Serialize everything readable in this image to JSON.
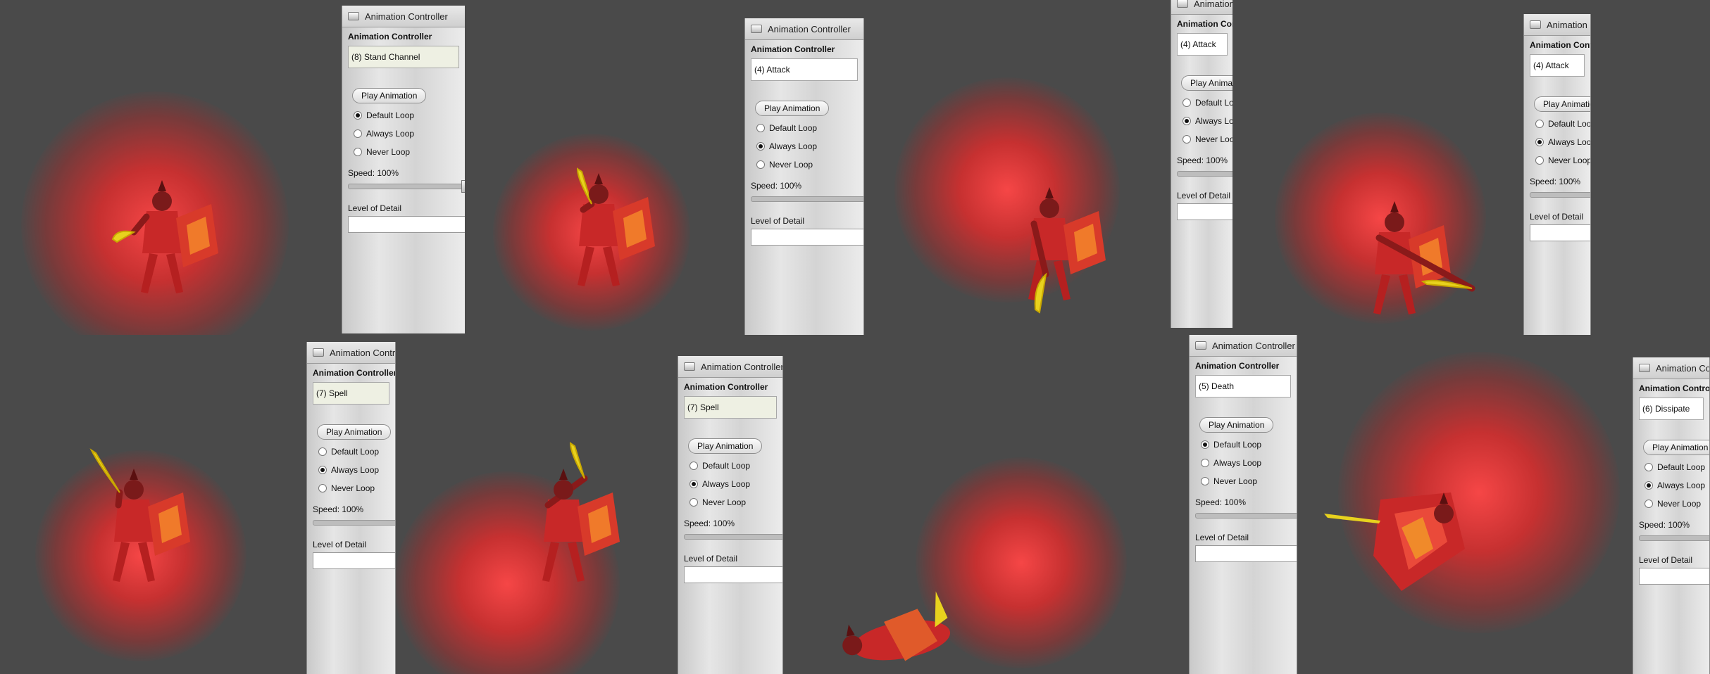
{
  "colors": {
    "background": "#4a4a4a",
    "glow": "#ff3b3b",
    "armor": "#c82828",
    "blade": "#e8d21e"
  },
  "panel_common": {
    "window_title": "Animation Controller",
    "header": "Animation Controller",
    "play_label": "Play Animation",
    "loop_options": [
      "Default Loop",
      "Always Loop",
      "Never Loop"
    ],
    "speed_label": "Speed: 100%",
    "lod_label": "Level of Detail"
  },
  "tiles": [
    {
      "animation": "(8) Stand Channel",
      "selected_loop": "Default Loop",
      "speed_percent": 100
    },
    {
      "animation": "(4) Attack",
      "selected_loop": "Always Loop",
      "speed_percent": 100
    },
    {
      "animation": "(4) Attack",
      "selected_loop": "Always Loop",
      "speed_percent": 100
    },
    {
      "animation": "(4) Attack",
      "selected_loop": "Always Loop",
      "speed_percent": 100
    },
    {
      "animation": "(7) Spell",
      "selected_loop": "Always Loop",
      "speed_percent": 100
    },
    {
      "animation": "(7) Spell",
      "selected_loop": "Always Loop",
      "speed_percent": 100
    },
    {
      "animation": "(5) Death",
      "selected_loop": "Default Loop",
      "speed_percent": 100
    },
    {
      "animation": "(6) Dissipate",
      "selected_loop": "Always Loop",
      "speed_percent": 100
    }
  ]
}
